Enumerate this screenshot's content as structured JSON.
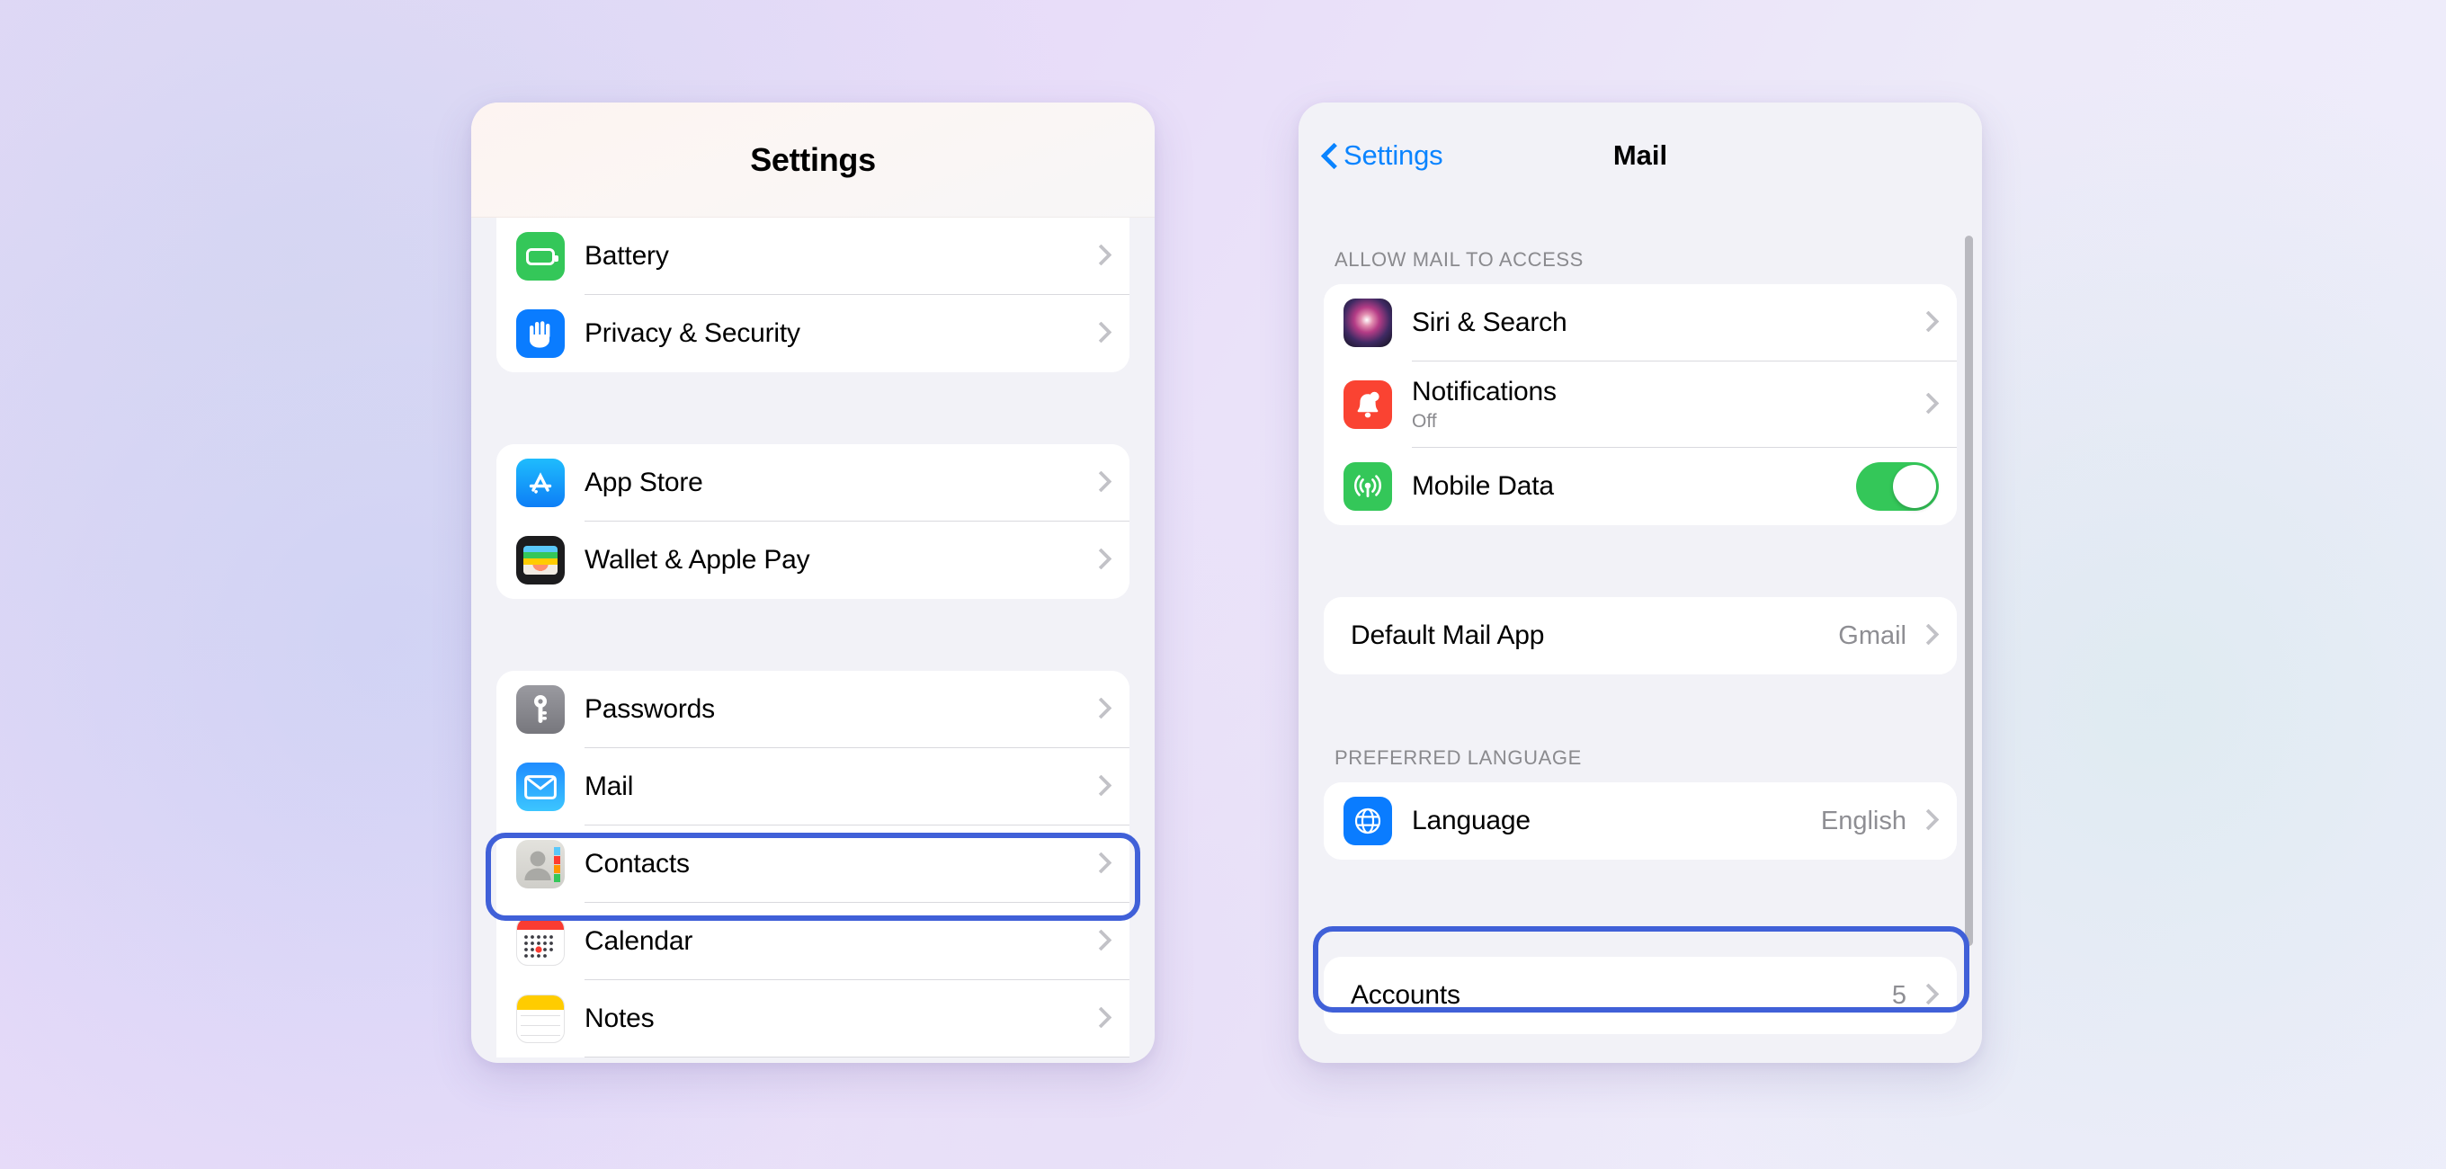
{
  "background": {
    "gradient_from": "#e4d8f8",
    "gradient_to": "#efeefb"
  },
  "accent": {
    "highlight_ring": "#4060d8",
    "ios_blue": "#0a84ff",
    "ios_green": "#34c759",
    "ios_red": "#fa4332",
    "value_gray": "#8e8e93"
  },
  "settings_panel": {
    "header_title": "Settings",
    "groups": [
      {
        "rows": [
          {
            "icon": "battery-icon",
            "label": "Battery",
            "accessory": "chevron"
          },
          {
            "icon": "privacy-hand-icon",
            "label": "Privacy & Security",
            "accessory": "chevron"
          }
        ]
      },
      {
        "rows": [
          {
            "icon": "app-store-icon",
            "label": "App Store",
            "accessory": "chevron"
          },
          {
            "icon": "wallet-icon",
            "label": "Wallet & Apple Pay",
            "accessory": "chevron"
          }
        ]
      },
      {
        "rows": [
          {
            "icon": "passwords-key-icon",
            "label": "Passwords",
            "accessory": "chevron"
          },
          {
            "icon": "mail-envelope-icon",
            "label": "Mail",
            "accessory": "chevron",
            "highlighted": true
          },
          {
            "icon": "contacts-icon",
            "label": "Contacts",
            "accessory": "chevron"
          },
          {
            "icon": "calendar-icon",
            "label": "Calendar",
            "accessory": "chevron"
          },
          {
            "icon": "notes-icon",
            "label": "Notes",
            "accessory": "chevron"
          }
        ]
      }
    ]
  },
  "mail_panel": {
    "back_label": "Settings",
    "title": "Mail",
    "sections": [
      {
        "header": "ALLOW MAIL TO ACCESS",
        "rows": [
          {
            "icon": "siri-icon",
            "label": "Siri & Search",
            "sub": "",
            "accessory": "chevron"
          },
          {
            "icon": "notifications-bell-icon",
            "label": "Notifications",
            "sub": "Off",
            "accessory": "chevron"
          },
          {
            "icon": "mobile-data-icon",
            "label": "Mobile Data",
            "sub": "",
            "accessory": "toggle",
            "toggle_on": true
          }
        ]
      },
      {
        "header": "",
        "rows": [
          {
            "icon": "",
            "label": "Default Mail App",
            "value": "Gmail",
            "accessory": "chevron"
          }
        ]
      },
      {
        "header": "PREFERRED LANGUAGE",
        "rows": [
          {
            "icon": "language-globe-icon",
            "label": "Language",
            "value": "English",
            "accessory": "chevron"
          }
        ]
      },
      {
        "header": "",
        "rows": [
          {
            "icon": "",
            "label": "Accounts",
            "value": "5",
            "accessory": "chevron",
            "highlighted": true
          }
        ]
      }
    ]
  }
}
